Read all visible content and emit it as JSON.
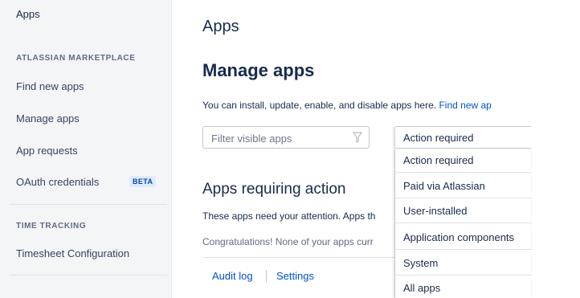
{
  "sidebar": {
    "top_label": "Apps",
    "section_marketplace": "ATLASSIAN MARKETPLACE",
    "items": [
      {
        "label": "Find new apps"
      },
      {
        "label": "Manage apps"
      },
      {
        "label": "App requests"
      },
      {
        "label": "OAuth credentials",
        "badge": "BETA"
      }
    ],
    "section_time": "TIME TRACKING",
    "time_items": [
      {
        "label": "Timesheet Configuration"
      }
    ]
  },
  "main": {
    "breadcrumb": "Apps",
    "title": "Manage apps",
    "description": "You can install, update, enable, and disable apps here.",
    "description_link": "Find new ap",
    "filter": {
      "placeholder": "Filter visible apps",
      "icon": "filter-funnel-icon"
    },
    "dropdown": {
      "selected": "Action required",
      "options": [
        "Action required",
        "Paid via Atlassian",
        "User-installed",
        "Application components",
        "System",
        "All apps"
      ]
    },
    "section_title": "Apps requiring action",
    "section_text": "These apps need your attention. Apps th",
    "congrats_text": "Congratulations! None of your apps curr",
    "footer": {
      "audit_log": "Audit log",
      "settings": "Settings"
    }
  },
  "colors": {
    "link": "#0052cc",
    "text": "#172b4d",
    "sidebar_bg": "#f4f5f7",
    "badge_text": "#0747a6",
    "badge_bg": "#deebff"
  }
}
